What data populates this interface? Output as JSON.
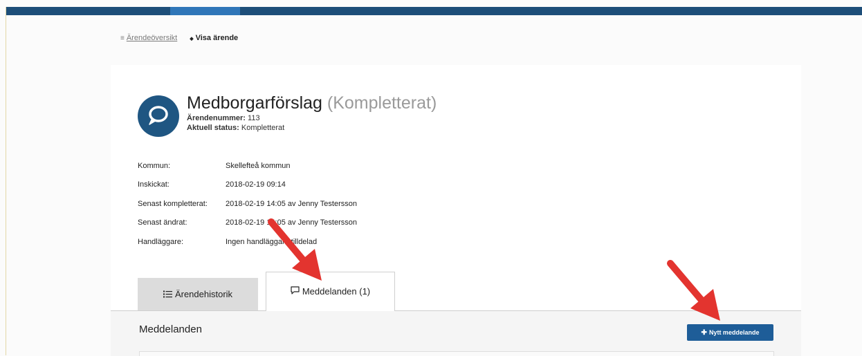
{
  "breadcrumb": {
    "overview_icon": "≡",
    "overview_label": "Ärendeöversikt",
    "current_icon": "◆",
    "current_label": "Visa ärende"
  },
  "case": {
    "icon": "speech-bubble-icon",
    "title": "Medborgarförslag",
    "status": "(Kompletterat)",
    "number_label": "Ärendenummer:",
    "number_value": "113",
    "status_label": "Aktuell status:",
    "status_value": "Kompletterat"
  },
  "details": [
    {
      "label": "Kommun:",
      "value": "Skellefteå kommun"
    },
    {
      "label": "Inskickat:",
      "value": "2018-02-19 09:14"
    },
    {
      "label": "Senast kompletterat:",
      "value": "2018-02-19 14:05 av Jenny Testersson"
    },
    {
      "label": "Senast ändrat:",
      "value": "2018-02-19 14:05 av Jenny Testersson"
    },
    {
      "label": "Handläggare:",
      "value": "Ingen handläggare tilldelad"
    }
  ],
  "tabs": {
    "history_label": "Ärendehistorik",
    "messages_label": "Meddelanden (1)"
  },
  "messages": {
    "title": "Meddelanden",
    "new_button_label": "Nytt meddelande"
  },
  "colors": {
    "topbar": "#1d4e79",
    "topbar_accent": "#2f76b8",
    "icon_bg": "#1f5682",
    "button": "#1e5d98",
    "arrow": "#e3342f"
  }
}
